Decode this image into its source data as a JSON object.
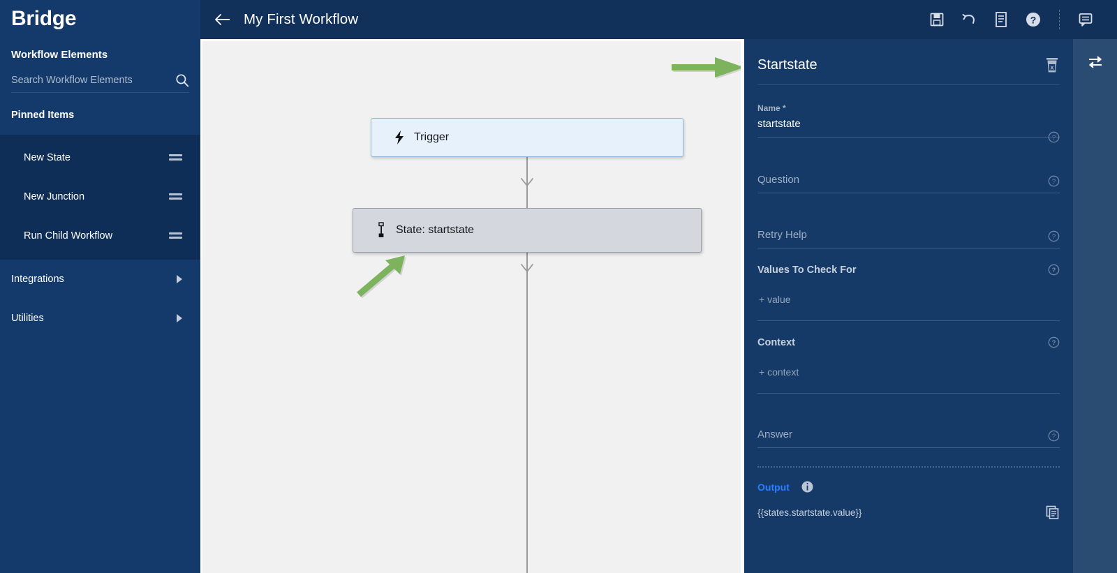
{
  "sidebar": {
    "brand": "Bridge",
    "section_title": "Workflow Elements",
    "search": {
      "placeholder": "Search Workflow Elements",
      "value": "",
      "icon": "search-icon"
    },
    "pinned_title": "Pinned Items",
    "pinned_items": [
      {
        "label": "New State",
        "handle_icon": "drag-handle-icon"
      },
      {
        "label": "New Junction",
        "handle_icon": "drag-handle-icon"
      },
      {
        "label": "Run Child Workflow",
        "handle_icon": "drag-handle-icon"
      }
    ],
    "nav_items": [
      {
        "label": "Integrations",
        "icon": "chevron-right-icon"
      },
      {
        "label": "Utilities",
        "icon": "chevron-right-icon"
      }
    ],
    "colors": {
      "background": "#143A6B",
      "pinned_background": "#0F2E57"
    }
  },
  "topbar": {
    "back_icon": "arrow-left-icon",
    "title": "My First Workflow",
    "tools": [
      {
        "name": "save-button",
        "icon": "save-floppy-icon"
      },
      {
        "name": "undo-button",
        "icon": "undo-arrow-icon"
      },
      {
        "name": "notes-button",
        "icon": "document-lines-icon"
      },
      {
        "name": "help-button",
        "icon": "question-circle-icon"
      },
      {
        "name": "comments-button",
        "icon": "comment-lines-icon"
      }
    ],
    "colors": {
      "background": "#11305A"
    }
  },
  "canvas": {
    "background": "#F1F1F1",
    "nodes": [
      {
        "id": "trigger",
        "label": "Trigger",
        "icon": "lightning-bolt-icon",
        "fill": "#E7F1FB",
        "border": "#8FB6DC"
      },
      {
        "id": "startstate",
        "label": "State: startstate",
        "icon": "state-pin-icon",
        "fill": "#D4D8DE",
        "border": "#9AA0A8"
      }
    ],
    "annotations": [
      {
        "name": "green-arrow-right",
        "color": "#7CB35C",
        "direction": "right"
      },
      {
        "name": "green-arrow-diagonal",
        "color": "#7CB35C",
        "direction": "up-right"
      }
    ]
  },
  "right_panel": {
    "title": "Startstate",
    "delete_icon": "trash-icon",
    "fields": [
      {
        "name": "name",
        "label": "Name *",
        "value": "startstate",
        "placeholder": "",
        "help_icon": "question-circle-outline-icon"
      },
      {
        "name": "question",
        "label": "",
        "value": "",
        "placeholder": "Question",
        "help_icon": "question-circle-outline-icon"
      },
      {
        "name": "retry-help",
        "label": "",
        "value": "",
        "placeholder": "Retry Help",
        "help_icon": "question-circle-outline-icon"
      }
    ],
    "list_fields": [
      {
        "name": "values-to-check-for",
        "label": "Values To Check For",
        "add_label": "+ value",
        "help_icon": "question-circle-outline-icon"
      },
      {
        "name": "context",
        "label": "Context",
        "add_label": "+ context",
        "help_icon": "question-circle-outline-icon"
      }
    ],
    "answer_field": {
      "name": "answer",
      "label": "",
      "value": "",
      "placeholder": "Answer",
      "help_icon": "question-circle-outline-icon"
    },
    "output": {
      "label": "Output",
      "info_icon": "info-circle-icon",
      "value": "{{states.startstate.value}}",
      "copy_icon": "copy-icon",
      "label_color": "#2A7FFF"
    },
    "colors": {
      "background": "#163A68",
      "rule": "#40628C"
    }
  },
  "rail": {
    "toggle_icon": "swap-arrows-icon",
    "background": "#2A4C72"
  }
}
